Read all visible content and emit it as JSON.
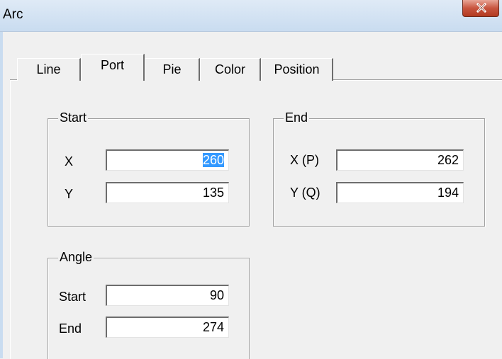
{
  "window": {
    "title": "Arc"
  },
  "tabs": [
    {
      "label": "Line",
      "active": false
    },
    {
      "label": "Port",
      "active": true
    },
    {
      "label": "Pie",
      "active": false
    },
    {
      "label": "Color",
      "active": false
    },
    {
      "label": "Position",
      "active": false
    }
  ],
  "start_group": {
    "label": "Start",
    "x_label": "X",
    "x_value": "260",
    "y_label": "Y",
    "y_value": "135"
  },
  "end_group": {
    "label": "End",
    "x_label": "X (P)",
    "x_value": "262",
    "y_label": "Y (Q)",
    "y_value": "194"
  },
  "angle_group": {
    "label": "Angle",
    "start_label": "Start",
    "start_value": "90",
    "end_label": "End",
    "end_value": "274"
  },
  "colors": {
    "titlebar": "#c9dcf0",
    "close_button": "#c8553f",
    "selection": "#3399ff",
    "background": "#f0f0f0"
  },
  "icons": {
    "close": "close-icon"
  }
}
